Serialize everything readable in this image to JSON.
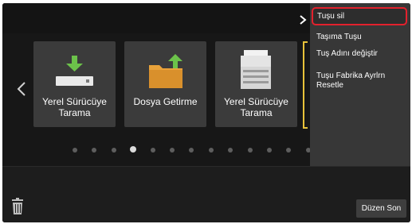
{
  "tiles": [
    {
      "label": "Yerel Sürücüye Tarama",
      "icon": "usb-drive-download-icon"
    },
    {
      "label": "Dosya Getirme",
      "icon": "folder-upload-icon"
    },
    {
      "label": "Yerel Sürücüye Tarama",
      "icon": "multifunction-printer-icon"
    }
  ],
  "pager": {
    "total_dots": 15,
    "active_index": 3
  },
  "context_menu": {
    "items": [
      {
        "label": "Tuşu sil",
        "selected": true
      },
      {
        "label": "Taşıma Tuşu"
      },
      {
        "label": "Tuş Adını değiştir"
      },
      {
        "label": "Tuşu Fabrika Ayrlrn Resetle"
      }
    ]
  },
  "footer": {
    "done_label": "Düzen Son"
  },
  "colors": {
    "selection_border": "#e3212d",
    "bracket": "#e8c23a",
    "accent_green": "#6cc24a",
    "folder": "#e8a23a"
  }
}
